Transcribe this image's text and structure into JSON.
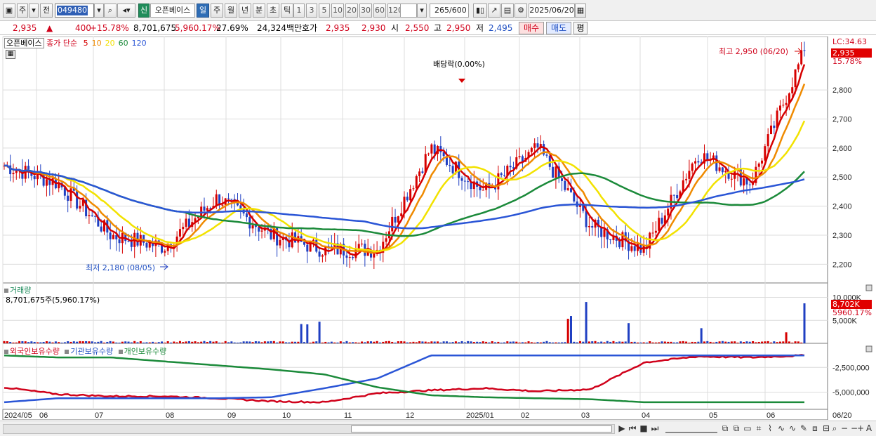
{
  "toolbar": {
    "market_label": "주",
    "prev_label": "전",
    "stock_code": "049480",
    "new_label": "신",
    "stock_name": "오픈베이스",
    "period_tabs": [
      "일",
      "주",
      "월",
      "년",
      "분",
      "초",
      "틱"
    ],
    "active_period": "일",
    "interval_buttons": [
      "1",
      "3",
      "5",
      "10",
      "20",
      "30",
      "60",
      "120"
    ],
    "count": "265",
    "count_max": "/600",
    "date": "2025/06/20"
  },
  "quote": {
    "price": "2,935",
    "change": "400",
    "change_pct": "+15.78%",
    "volume": "8,701,675",
    "volume_pct": "5,960.17%",
    "turnover": "27.69%",
    "amount": "24,324백만",
    "bid_label": "호가",
    "ask": "2,935",
    "bid": "2,930",
    "open_label": "시",
    "open": "2,550",
    "high_label": "고",
    "high": "2,950",
    "low_label": "저",
    "low": "2,495",
    "buy_label": "매수",
    "sell_label": "매도",
    "eval_label": "평"
  },
  "price_panel": {
    "name": "오픈베이스",
    "ma_label": "종가 단순",
    "ma_periods": [
      "5",
      "10",
      "20",
      "60",
      "120"
    ],
    "ma_colors": [
      "#d60000",
      "#ef8a00",
      "#f2e200",
      "#1b8a3a",
      "#2a55d6"
    ],
    "lc": "LC:34.63",
    "last_price": "2,935",
    "last_pct": "15.78%",
    "high_annotation": "최고 2,950 (06/20)",
    "low_annotation": "최저 2,180 (08/05)",
    "dividend_annotation": "배당락(0.00%)",
    "y_ticks": [
      "2,800",
      "2,700",
      "2,600",
      "2,500",
      "2,400",
      "2,300",
      "2,200"
    ]
  },
  "volume_panel": {
    "title": "거래량",
    "value": "8,701,675주(5,960.17%)",
    "last": "8,702K",
    "last_pct": "5960.17%",
    "y_ticks": [
      "10,000K",
      "5,000K"
    ]
  },
  "holding_panel": {
    "series": [
      "외국인보유수량",
      "기관보유수량",
      "개인보유수량"
    ],
    "colors": [
      "#d0021b",
      "#2a55d6",
      "#1b8a3a"
    ],
    "y_ticks": [
      "-2,500,000",
      "-5,000,000"
    ]
  },
  "x_axis": [
    "2024/05",
    "06",
    "07",
    "08",
    "09",
    "10",
    "11",
    "12",
    "2025/01",
    "02",
    "03",
    "04",
    "05",
    "06",
    "06/20"
  ],
  "chart_data": {
    "type": "line",
    "title": "오픈베이스",
    "x": [
      "2024/05",
      "06",
      "07",
      "08",
      "09",
      "10",
      "11",
      "12",
      "2025/01",
      "02",
      "03",
      "04",
      "05",
      "06",
      "06/20"
    ],
    "series": [
      {
        "name": "5",
        "values": [
          2540,
          2480,
          2300,
          2260,
          2430,
          2300,
          2250,
          2250,
          2600,
          2450,
          2600,
          2330,
          2250,
          2580,
          2480,
          2935
        ]
      },
      {
        "name": "120",
        "values": [
          2570,
          2560,
          2520,
          2470,
          2440,
          2400,
          2380,
          2350,
          2330,
          2360,
          2380,
          2400,
          2400,
          2450,
          2470,
          2480
        ]
      }
    ],
    "ylim": [
      2150,
      2960
    ],
    "volume_ylim": [
      0,
      11000
    ]
  }
}
